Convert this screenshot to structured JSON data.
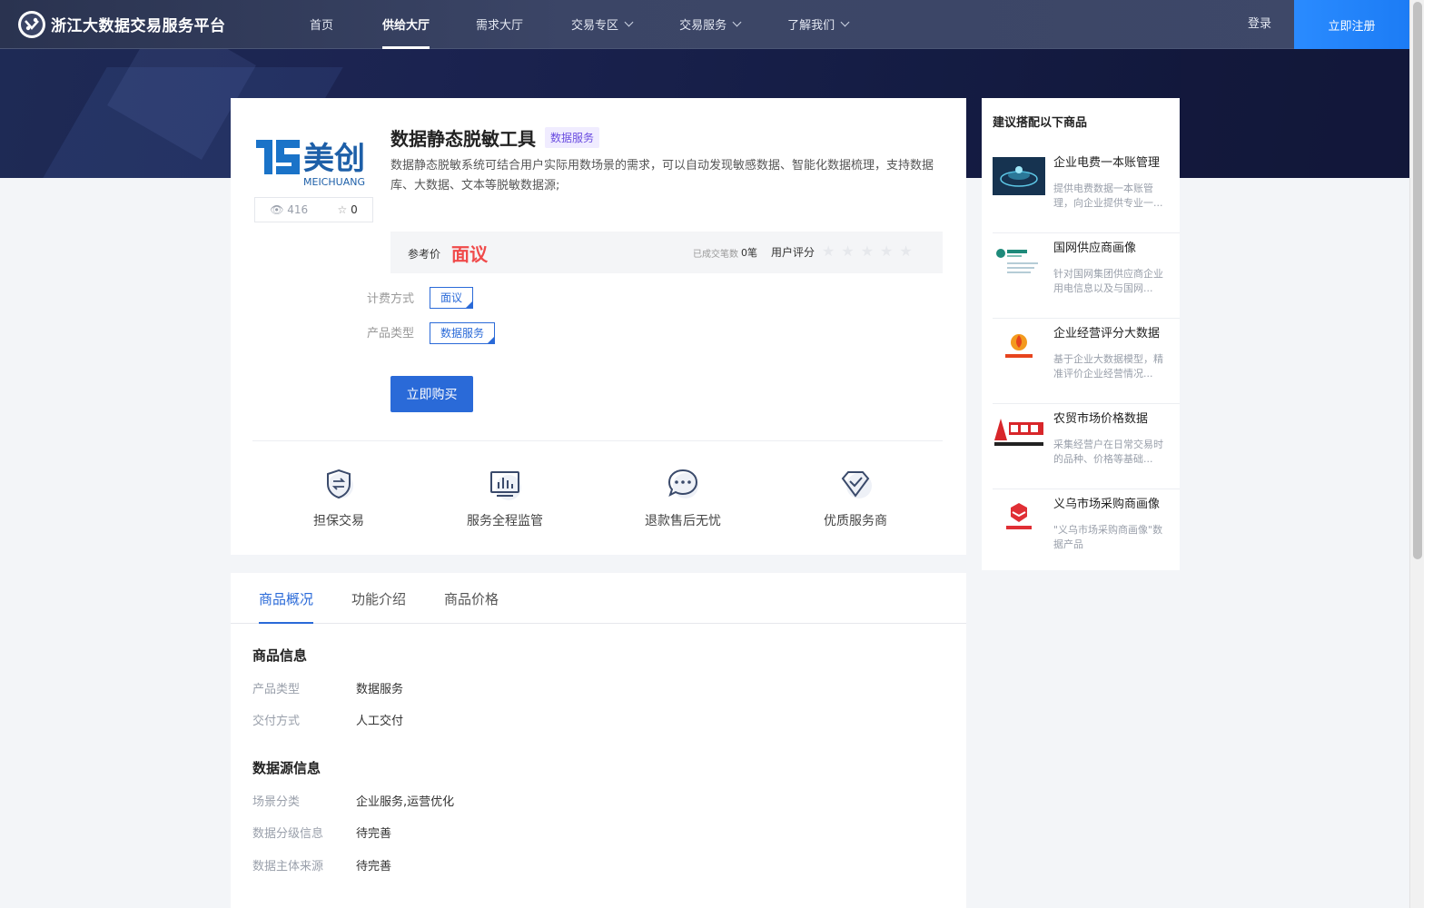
{
  "header": {
    "logo_text": "浙江大数据交易服务平台",
    "nav": [
      {
        "label": "首页",
        "active": false,
        "dropdown": false
      },
      {
        "label": "供给大厅",
        "active": true,
        "dropdown": false
      },
      {
        "label": "需求大厅",
        "active": false,
        "dropdown": false
      },
      {
        "label": "交易专区",
        "active": false,
        "dropdown": true
      },
      {
        "label": "交易服务",
        "active": false,
        "dropdown": true
      },
      {
        "label": "了解我们",
        "active": false,
        "dropdown": true
      }
    ],
    "login_label": "登录",
    "register_label": "立即注册"
  },
  "product": {
    "brand_name": "美创",
    "brand_sub": "MEICHUANG",
    "views": "416",
    "favorites": "0",
    "title": "数据静态脱敏工具",
    "tag": "数据服务",
    "description": "数据静态脱敏系统可结合用户实际用数场景的需求，可以自动发现敏感数据、智能化数据梳理，支持数据库、大数据、文本等脱敏数据源;",
    "price_label": "参考价",
    "price_value": "面议",
    "deal_label": "已成交笔数",
    "deal_count": "0笔",
    "rating_label": "用户评分",
    "rating": 0,
    "billing_label": "计费方式",
    "billing_value": "面议",
    "type_label": "产品类型",
    "type_value": "数据服务",
    "buy_label": "立即购买"
  },
  "features": [
    {
      "label": "担保交易",
      "icon": "shield-exchange-icon"
    },
    {
      "label": "服务全程监管",
      "icon": "monitor-chart-icon"
    },
    {
      "label": "退款售后无忧",
      "icon": "chat-bubble-icon"
    },
    {
      "label": "优质服务商",
      "icon": "diamond-check-icon"
    }
  ],
  "side": {
    "title": "建议搭配以下商品",
    "items": [
      {
        "title": "企业电费一本账管理",
        "desc": "提供电费数据一本账管理，向企业提供专业一..."
      },
      {
        "title": "国网供应商画像",
        "desc": "针对国网集团供应商企业用电信息以及与国网..."
      },
      {
        "title": "企业经营评分大数据",
        "desc": "基于企业大数据模型，精准评价企业经营情况..."
      },
      {
        "title": "农贸市场价格数据",
        "desc": "采集经营户在日常交易时的品种、价格等基础..."
      },
      {
        "title": "义乌市场采购商画像",
        "desc": "\"义乌市场采购商画像\"数据产品"
      }
    ]
  },
  "tabs": [
    "商品概况",
    "功能介绍",
    "商品价格"
  ],
  "info": {
    "section1_title": "商品信息",
    "product_type_k": "产品类型",
    "product_type_v": "数据服务",
    "delivery_k": "交付方式",
    "delivery_v": "人工交付",
    "section2_title": "数据源信息",
    "scene_k": "场景分类",
    "scene_v": "企业服务,运营优化",
    "grade_k": "数据分级信息",
    "grade_v": "待完善",
    "source_k": "数据主体来源",
    "source_v": "待完善"
  },
  "colors": {
    "accent": "#2a6ad8",
    "price": "#f04a4a",
    "nav_bg": "#2e3756"
  }
}
